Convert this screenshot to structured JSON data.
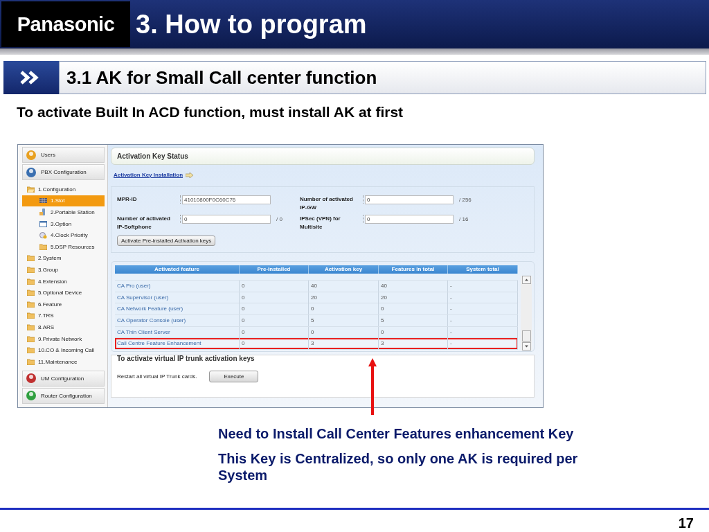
{
  "slide": {
    "logo": "Panasonic",
    "title": "3. How to program",
    "section_title": "3.1 AK for Small Call center function",
    "heading": "To activate Built In ACD function, must install AK at first",
    "page_number": "17"
  },
  "screenshot": {
    "sidebar": [
      {
        "label": "Users",
        "kind": "users"
      },
      {
        "label": "PBX Configuration",
        "kind": "pbx",
        "children": [
          {
            "label": "1.Configuration",
            "kind": "folder",
            "expanded": true,
            "selected": false,
            "children": [
              {
                "label": "1.Slot",
                "kind": "slot",
                "selected": true
              },
              {
                "label": "2.Portable Station",
                "kind": "station",
                "selected": false
              },
              {
                "label": "3.Option",
                "kind": "option",
                "selected": false
              },
              {
                "label": "4.Clock Priority",
                "kind": "clock",
                "selected": false
              },
              {
                "label": "5.DSP Resources",
                "kind": "folder",
                "selected": false
              }
            ]
          },
          {
            "label": "2.System",
            "kind": "folder",
            "selected": false
          },
          {
            "label": "3.Group",
            "kind": "folder",
            "selected": false
          },
          {
            "label": "4.Extension",
            "kind": "folder",
            "selected": false
          },
          {
            "label": "5.Optional Device",
            "kind": "folder",
            "selected": false
          },
          {
            "label": "6.Feature",
            "kind": "folder",
            "selected": false
          },
          {
            "label": "7.TRS",
            "kind": "folder",
            "selected": false
          },
          {
            "label": "8.ARS",
            "kind": "folder",
            "selected": false
          },
          {
            "label": "9.Private Network",
            "kind": "folder",
            "selected": false
          },
          {
            "label": "10.CO & Incoming Call",
            "kind": "folder",
            "selected": false
          },
          {
            "label": "11.Maintenance",
            "kind": "folder",
            "selected": false
          }
        ]
      },
      {
        "label": "UM Configuration",
        "kind": "um"
      },
      {
        "label": "Router Configuration",
        "kind": "router"
      }
    ],
    "panel_title": "Activation Key Status",
    "link": "Activation Key Installation",
    "fields": [
      {
        "label": "MPR-ID",
        "value": "41010800F0C60C76"
      },
      {
        "label": "Number of activated IP-GW",
        "value": "0",
        "suffix": "/ 256"
      },
      {
        "label": "Number of activated IP-Softphone",
        "value": "0",
        "suffix": "/ 0"
      },
      {
        "label": "IPSec (VPN) for Multisite",
        "value": "0",
        "suffix": "/ 16"
      }
    ],
    "activate_button": "Activate Pre-installed Activation keys",
    "table": {
      "columns": [
        "Activated feature",
        "Pre-installed",
        "Activation key",
        "Features in total",
        "System total"
      ],
      "rows": [
        {
          "cells": [
            "CA Pro (user)",
            "0",
            "40",
            "40",
            "-"
          ],
          "highlighted": false
        },
        {
          "cells": [
            "CA Supervisor (user)",
            "0",
            "20",
            "20",
            "-"
          ],
          "highlighted": false
        },
        {
          "cells": [
            "CA Network Feature (user)",
            "0",
            "0",
            "0",
            "-"
          ],
          "highlighted": false
        },
        {
          "cells": [
            "CA Operator Console (user)",
            "0",
            "5",
            "5",
            "-"
          ],
          "highlighted": false
        },
        {
          "cells": [
            "CA Thin Client Server",
            "0",
            "0",
            "0",
            "-"
          ],
          "highlighted": false
        },
        {
          "cells": [
            "Call Centre Feature Enhancement",
            "0",
            "3",
            "3",
            "-"
          ],
          "highlighted": true
        }
      ]
    },
    "trunk_group": {
      "title": "To activate virtual IP trunk activation keys",
      "text": "Restart all virtual IP Trunk cards.",
      "button": "Execute"
    }
  },
  "notes": [
    "Need to Install Call Center Features enhancement Key",
    "This Key is Centralized, so only one AK is required per System"
  ]
}
